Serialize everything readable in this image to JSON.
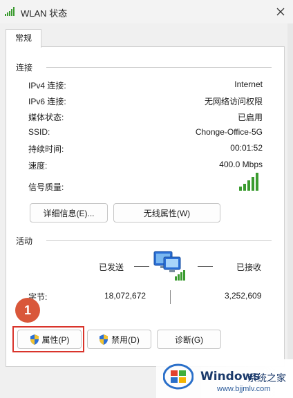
{
  "window": {
    "title": "WLAN 状态",
    "close_icon": "close-icon"
  },
  "tabs": [
    {
      "label": "常规"
    }
  ],
  "connection": {
    "group_label": "连接",
    "rows": [
      {
        "label": "IPv4 连接:",
        "value": "Internet"
      },
      {
        "label": "IPv6 连接:",
        "value": "无网络访问权限"
      },
      {
        "label": "媒体状态:",
        "value": "已启用"
      },
      {
        "label": "SSID:",
        "value": "Chonge-Office-5G"
      },
      {
        "label": "持续时间:",
        "value": "00:01:52"
      },
      {
        "label": "速度:",
        "value": "400.0 Mbps"
      }
    ],
    "signal_label": "信号质量:",
    "signal_bars": 5,
    "details_button": "详细信息(E)...",
    "wireless_button": "无线属性(W)"
  },
  "activity": {
    "group_label": "活动",
    "sent_label": "已发送",
    "received_label": "已接收",
    "bytes_label": "字节:",
    "bytes_sent": "18,072,672",
    "bytes_received": "3,252,609"
  },
  "buttons": {
    "properties": "属性(P)",
    "disable": "禁用(D)",
    "diagnose": "诊断(G)"
  },
  "annotation": {
    "badge": "1",
    "color": "#d9342b"
  },
  "watermark": {
    "brand": "Windows",
    "site_name": "系统之家",
    "url": "www.bjjmlv.com"
  },
  "colors": {
    "signal": "#3a9b2f",
    "shield_blue": "#2b6fd6",
    "shield_yellow": "#f2c230"
  }
}
